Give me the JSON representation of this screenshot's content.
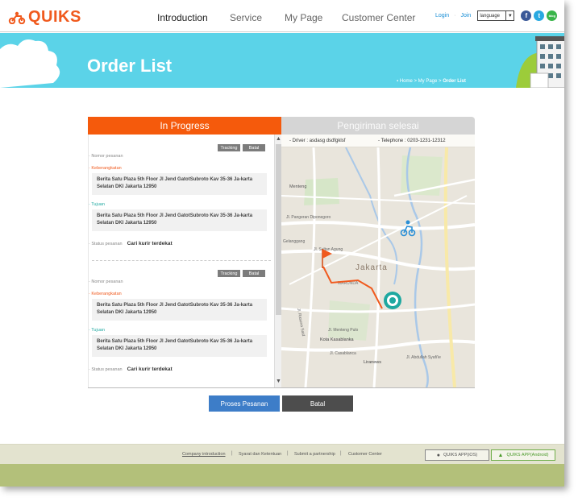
{
  "brand": {
    "name": "QUIKS",
    "accent": "#f05a1e"
  },
  "nav": {
    "items": [
      {
        "label": "Introduction",
        "active": true
      },
      {
        "label": "Service",
        "active": false
      },
      {
        "label": "My Page",
        "active": false
      },
      {
        "label": "Customer Center",
        "active": false
      }
    ]
  },
  "top_links": {
    "login": "Login",
    "join": "Join",
    "language": "language"
  },
  "social": [
    {
      "icon": "facebook-icon",
      "glyph": "f",
      "color": "#3b5998"
    },
    {
      "icon": "twitter-icon",
      "glyph": "t",
      "color": "#29a9e1"
    },
    {
      "icon": "blog-icon",
      "glyph": "blog",
      "color": "#39b54a"
    }
  ],
  "banner": {
    "title": "Order List",
    "breadcrumb": [
      "Home",
      "My Page",
      "Order List"
    ]
  },
  "tabs": {
    "in_progress": "In Progress",
    "completed": "Pengiriman selesai"
  },
  "order_labels": {
    "order_number": "Nomor pesanan",
    "departure": "Keberangkatan",
    "destination": "Tujuan",
    "status": "Status pesanan",
    "tracking_btn": "Tracking",
    "cancel_btn": "Batal"
  },
  "orders": [
    {
      "departure_address": "Berita Satu Plaza 5th Floor Jl Jend GatotSubroto Kav 35-36 Ja-karta Selatan DKI Jakarta 12950",
      "destination_address": "Berita Satu Plaza 5th Floor Jl Jend GatotSubroto Kav 35-36 Ja-karta Selatan DKI Jakarta 12950",
      "status": "Cari kurir terdekat"
    },
    {
      "departure_address": "Berita Satu Plaza 5th Floor Jl Jend GatotSubroto Kav 35-36 Ja-karta Selatan DKI Jakarta 12950",
      "destination_address": "Berita Satu Plaza 5th Floor Jl Jend GatotSubroto Kav 35-36 Ja-karta Selatan DKI Jakarta 12950",
      "status": "Cari kurir terdekat"
    }
  ],
  "map_info": {
    "driver_label": "Driver :",
    "driver_value": "asdasg dsdfgklsf",
    "phone_label": "Telephone :",
    "phone_value": "0203-1231-12312"
  },
  "map_labels": {
    "city": "Jakarta",
    "district1": "Menteng",
    "district2": "Kota Kasablanka",
    "district3": "Liranews",
    "road1": "Jl. Pangeran Diponegoro",
    "road2": "Jl. Casablanca",
    "road3": "Jl. Abdullah Syafi'ie",
    "road4": "Jl. Menteng Pulo",
    "road5": "Jl. Rasuna Said",
    "road6": "Gelanggang",
    "road7": "Jl. Sultan Agung",
    "road8": "MARUNDA"
  },
  "actions": {
    "submit": "Proses Pesanan",
    "cancel": "Batal"
  },
  "footer": {
    "links": [
      "Company introduction",
      "Syarat dan Ketentuan",
      "Submit a partnership",
      "Customer Center"
    ],
    "app_ios": "QUIKS APP(iOS)",
    "app_android": "QUIKS APP(Android)"
  }
}
